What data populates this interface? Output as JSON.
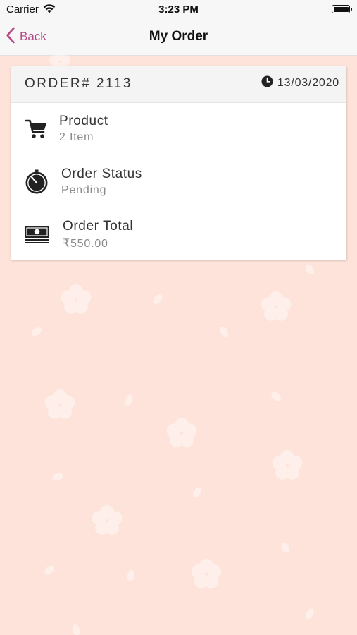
{
  "status_bar": {
    "carrier": "Carrier",
    "time": "3:23 PM"
  },
  "nav": {
    "back_label": "Back",
    "title": "My Order"
  },
  "order": {
    "number_label": "ORDER# 2113",
    "date": "13/03/2020",
    "rows": [
      {
        "title": "Product",
        "value": "2 Item",
        "icon": "cart-icon"
      },
      {
        "title": "Order Status",
        "value": "Pending",
        "icon": "timer-icon"
      },
      {
        "title": "Order Total",
        "value": "₹550.00",
        "icon": "cash-icon"
      }
    ]
  },
  "colors": {
    "accent": "#b54a86",
    "background": "#fde3d9",
    "nav_background": "#f7f7f7",
    "card_header": "#f4f4f4"
  }
}
